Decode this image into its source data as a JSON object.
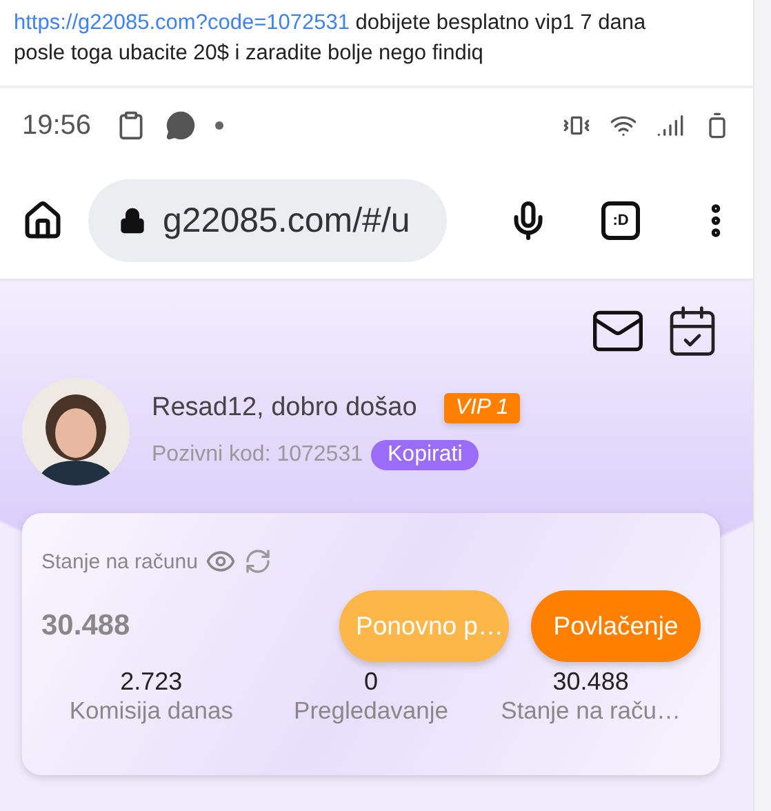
{
  "post": {
    "link": "https://g22085.com?code=1072531",
    "text": "dobijete besplatno vip1 7 dana posle toga ubacite 20$ i zaradite bolje nego findiq"
  },
  "status_bar": {
    "time": "19:56"
  },
  "address_bar": {
    "url": "g22085.com/#/u"
  },
  "tab_switcher": {
    "label": ":D"
  },
  "profile": {
    "greeting": "Resad12, dobro došao",
    "vip": "VIP 1",
    "invite_code": "Pozivni kod: 1072531",
    "copy_button": "Kopirati"
  },
  "balance_card": {
    "label": "Stanje na računu",
    "amount": "30.488",
    "buttons": [
      {
        "kind": "secondary",
        "label": "Ponovno p…"
      },
      {
        "kind": "primary",
        "label": "Povlačenje"
      }
    ],
    "stats": [
      {
        "value": "2.723",
        "label": "Komisija danas"
      },
      {
        "value": "0",
        "label": "Pregledavanje"
      },
      {
        "value": "30.488",
        "label": "Stanje na raču…"
      }
    ]
  }
}
